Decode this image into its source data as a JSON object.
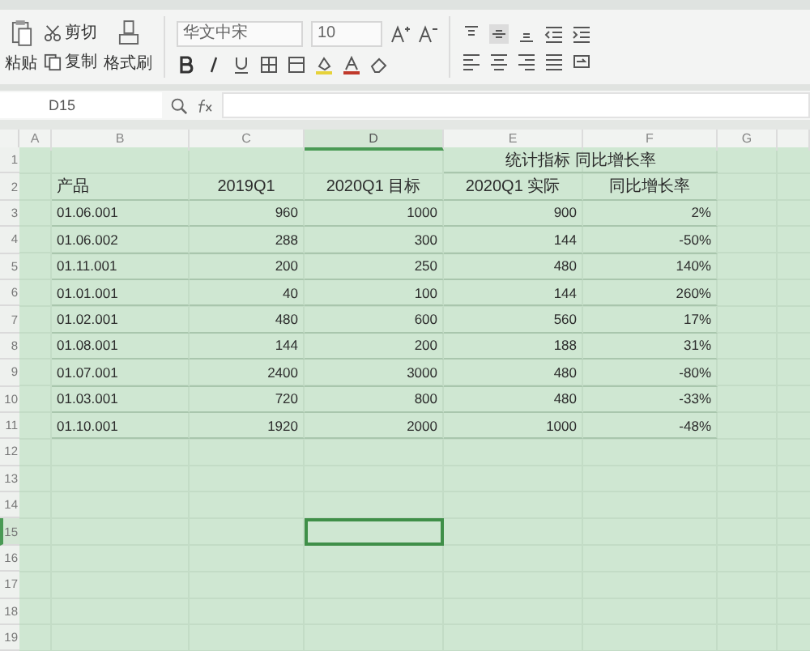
{
  "ribbon": {
    "paste": "粘贴",
    "cut": "剪切",
    "copy": "复制",
    "format_painter": "格式刷",
    "font_name": "华文中宋",
    "font_size": "10"
  },
  "formula_bar": {
    "name_box": "D15"
  },
  "sheet": {
    "columns": [
      {
        "label": "A",
        "selected": false
      },
      {
        "label": "B",
        "selected": false
      },
      {
        "label": "C",
        "selected": false
      },
      {
        "label": "D",
        "selected": true
      },
      {
        "label": "E",
        "selected": false
      },
      {
        "label": "F",
        "selected": false
      },
      {
        "label": "G",
        "selected": false
      }
    ],
    "rows": [
      {
        "number": "1",
        "selected": false
      },
      {
        "number": "2",
        "selected": false
      },
      {
        "number": "3",
        "selected": false
      },
      {
        "number": "4",
        "selected": false
      },
      {
        "number": "5",
        "selected": false
      },
      {
        "number": "6",
        "selected": false
      },
      {
        "number": "7",
        "selected": false
      },
      {
        "number": "8",
        "selected": false
      },
      {
        "number": "9",
        "selected": false
      },
      {
        "number": "10",
        "selected": false
      },
      {
        "number": "11",
        "selected": false
      },
      {
        "number": "12",
        "selected": false
      },
      {
        "number": "13",
        "selected": false
      },
      {
        "number": "14",
        "selected": false
      },
      {
        "number": "15",
        "selected": true
      },
      {
        "number": "16",
        "selected": false
      },
      {
        "number": "17",
        "selected": false
      },
      {
        "number": "18",
        "selected": false
      },
      {
        "number": "19",
        "selected": false
      }
    ],
    "title": "统计指标 同比增长率",
    "headers": [
      "产品",
      "2019Q1",
      "2020Q1 目标",
      "2020Q1 实际",
      "同比增长率"
    ],
    "data": [
      [
        "01.06.001",
        "960",
        "1000",
        "900",
        "2%"
      ],
      [
        "01.06.002",
        "288",
        "300",
        "144",
        "-50%"
      ],
      [
        "01.11.001",
        "200",
        "250",
        "480",
        "140%"
      ],
      [
        "01.01.001",
        "40",
        "100",
        "144",
        "260%"
      ],
      [
        "01.02.001",
        "480",
        "600",
        "560",
        "17%"
      ],
      [
        "01.08.001",
        "144",
        "200",
        "188",
        "31%"
      ],
      [
        "01.07.001",
        "2400",
        "3000",
        "480",
        "-80%"
      ],
      [
        "01.03.001",
        "720",
        "800",
        "480",
        "-33%"
      ],
      [
        "01.10.001",
        "1920",
        "2000",
        "1000",
        "-48%"
      ]
    ]
  }
}
